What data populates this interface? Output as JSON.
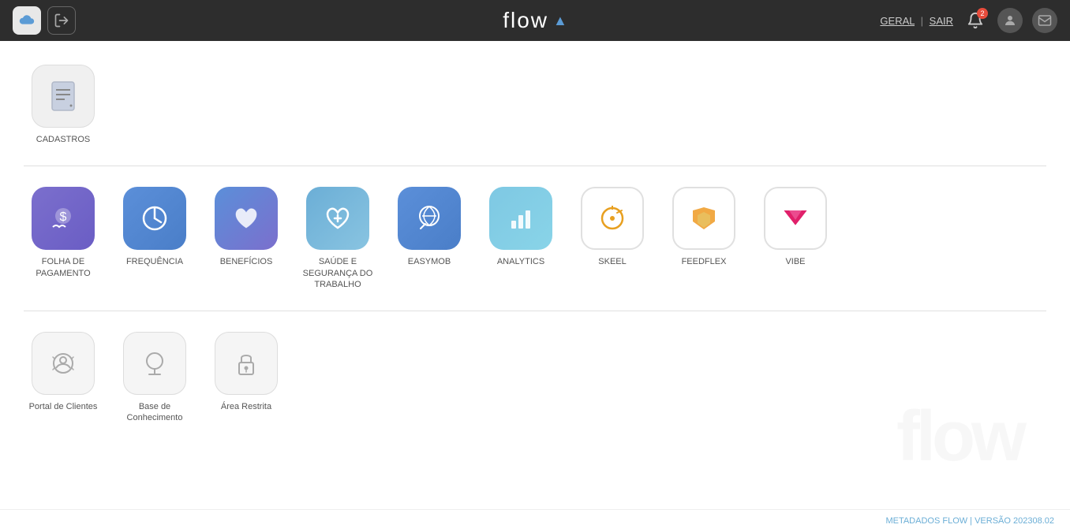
{
  "header": {
    "logo": "flow",
    "geral_label": "GERAL",
    "sair_label": "SAIR",
    "notification_count": "2"
  },
  "footer": {
    "text": "METADADOS FLOW | VERSÃO 202308.02"
  },
  "sections": [
    {
      "id": "cadastros",
      "apps": [
        {
          "id": "cadastros",
          "label": "CADASTROS",
          "icon_type": "cadastros"
        }
      ]
    },
    {
      "id": "main-apps",
      "apps": [
        {
          "id": "folha",
          "label": "FOLHA DE PAGAMENTO",
          "icon_type": "folha"
        },
        {
          "id": "frequencia",
          "label": "FREQUÊNCIA",
          "icon_type": "frequencia"
        },
        {
          "id": "beneficios",
          "label": "BENEFÍCIOS",
          "icon_type": "beneficios"
        },
        {
          "id": "saude",
          "label": "SAÚDE E SEGURANÇA DO TRABALHO",
          "icon_type": "saude"
        },
        {
          "id": "easymob",
          "label": "EASYMOB",
          "icon_type": "easymob"
        },
        {
          "id": "analytics",
          "label": "ANALYTICS",
          "icon_type": "analytics"
        },
        {
          "id": "skeel",
          "label": "SKEEL",
          "icon_type": "skeel"
        },
        {
          "id": "feedflex",
          "label": "FEEDFLEX",
          "icon_type": "feedflex"
        },
        {
          "id": "vibe",
          "label": "VIBE",
          "icon_type": "vibe"
        }
      ]
    },
    {
      "id": "tools",
      "apps": [
        {
          "id": "portal",
          "label": "Portal de Clientes",
          "icon_type": "portal"
        },
        {
          "id": "base",
          "label": "Base de Conhecimento",
          "icon_type": "base"
        },
        {
          "id": "restrita",
          "label": "Área Restrita",
          "icon_type": "restrita"
        }
      ]
    }
  ]
}
